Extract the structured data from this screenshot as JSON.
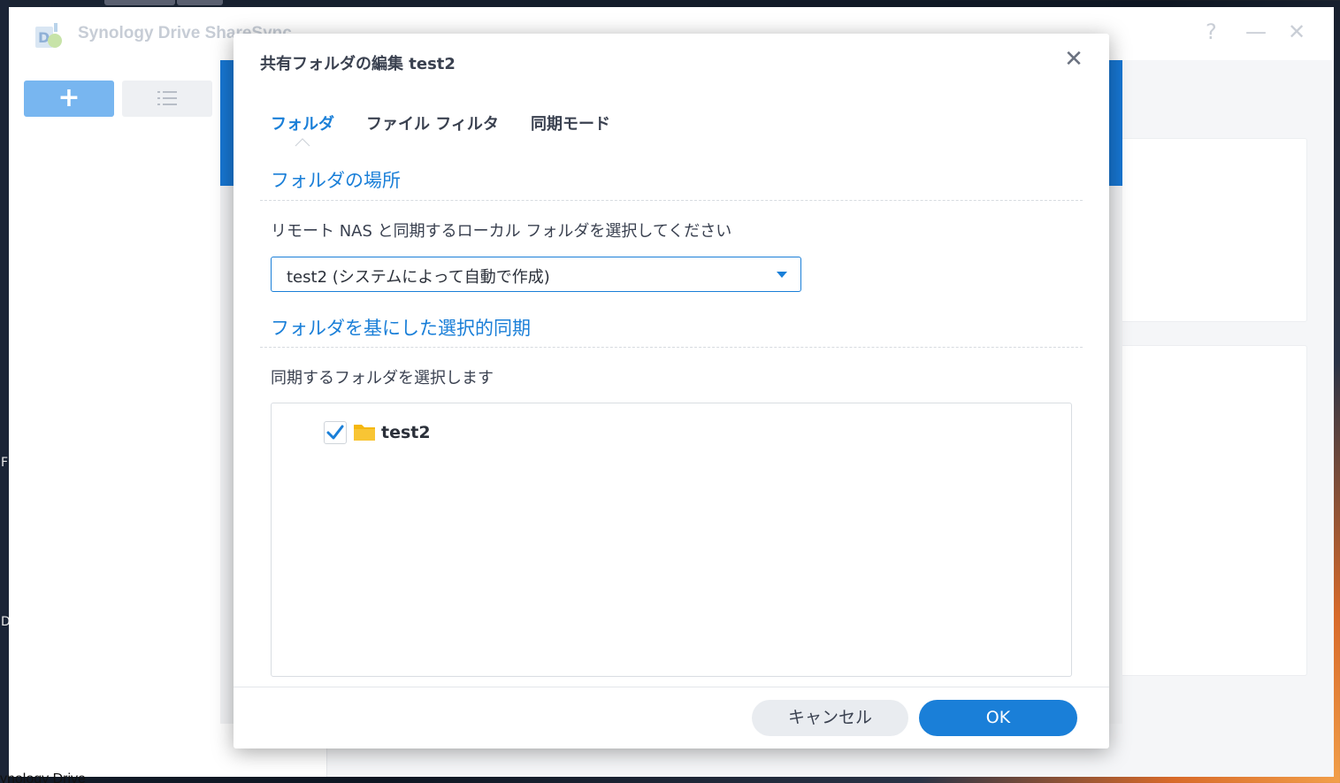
{
  "app": {
    "title": "Synology Drive ShareSync",
    "window_controls": {
      "help": "?",
      "minimize": "—",
      "close": "✕"
    },
    "sidebar": {
      "add_label": "+"
    },
    "desktop_bottom_label": "ynology Drive",
    "desktop_letters": [
      "F",
      "D"
    ]
  },
  "dialog": {
    "title": "共有フォルダの編集 test2",
    "close_label": "✕",
    "tabs": [
      {
        "label": "フォルダ",
        "active": true
      },
      {
        "label": "ファイル フィルタ",
        "active": false
      },
      {
        "label": "同期モード",
        "active": false
      }
    ],
    "location_section": {
      "title": "フォルダの場所",
      "description": "リモート NAS と同期するローカル フォルダを選択してください",
      "selected_folder": "test2 (システムによって自動で作成)"
    },
    "selective_sync_section": {
      "title": "フォルダを基にした選択的同期",
      "description": "同期するフォルダを選択します",
      "tree": [
        {
          "name": "test2",
          "checked": true
        }
      ]
    },
    "footer": {
      "cancel_label": "キャンセル",
      "ok_label": "OK"
    }
  },
  "colors": {
    "accent": "#1a7fd8",
    "folder": "#f5b70f",
    "wizard_header": "#1776d2"
  }
}
